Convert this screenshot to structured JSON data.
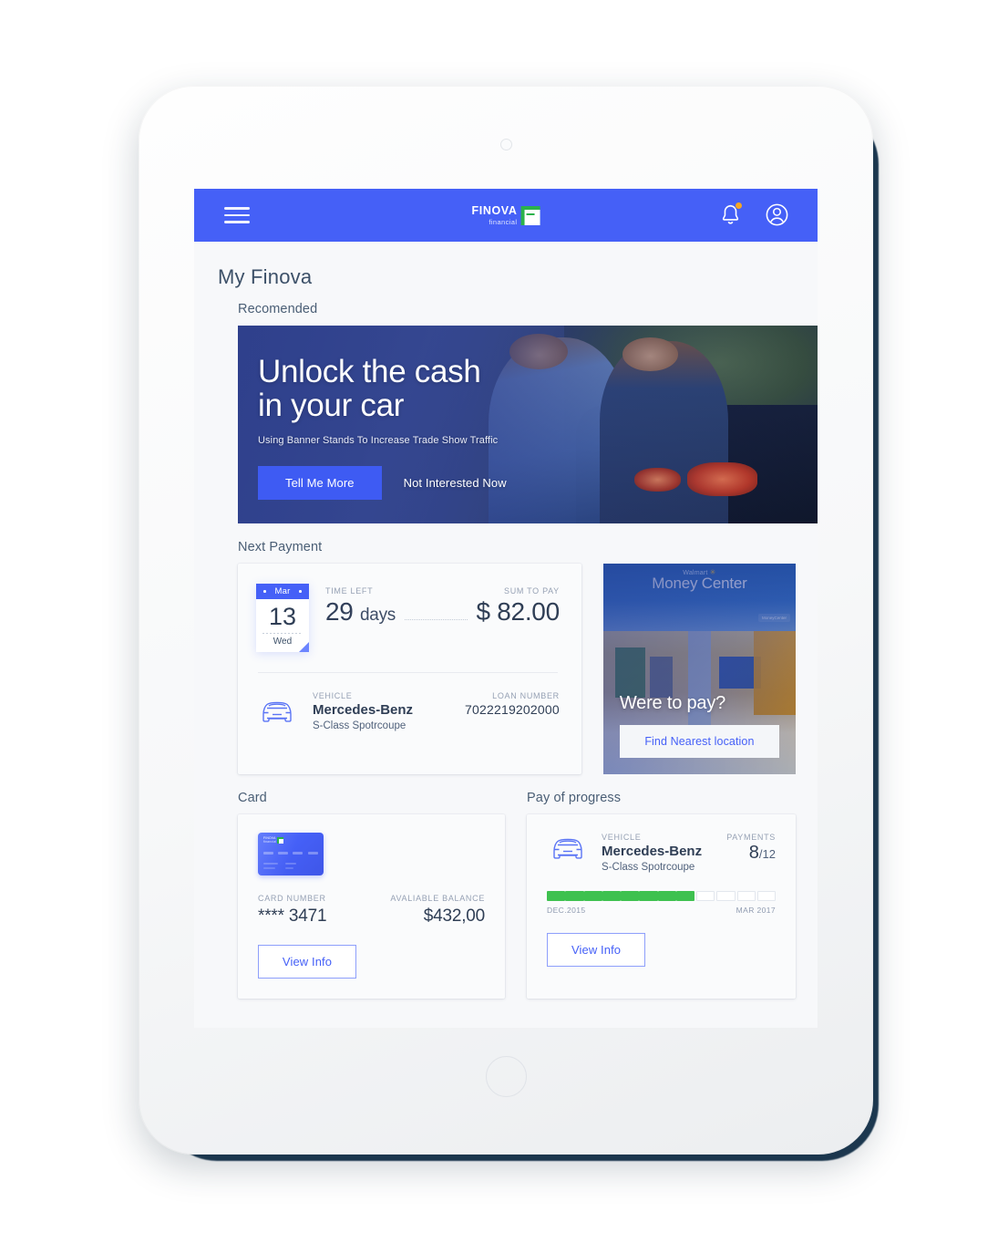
{
  "appbar": {
    "menu_label": "menu",
    "brand_main": "FINOVA",
    "brand_sub": "financial",
    "notifications_label": "notifications",
    "profile_label": "profile"
  },
  "page": {
    "title": "My Finova"
  },
  "recommended": {
    "section_label": "Recomended",
    "hero_title_line1": "Unlock the cash",
    "hero_title_line2": "in your car",
    "hero_subtitle": "Using Banner Stands To Increase Trade Show Traffic",
    "primary_cta": "Tell Me More",
    "secondary_cta": "Not Interested Now"
  },
  "next_payment": {
    "section_label": "Next Payment",
    "calendar": {
      "month": "Mar",
      "day": "13",
      "weekday": "Wed"
    },
    "time_left_label": "TIME LEFT",
    "time_left_value": "29",
    "time_left_unit": "days",
    "sum_to_pay_label": "SUM TO PAY",
    "sum_to_pay_value": "$ 82.00",
    "vehicle_label": "VEHICLE",
    "vehicle_name": "Mercedes-Benz",
    "vehicle_model": "S-Class Spotrcoupe",
    "loan_number_label": "LOAN NUMBER",
    "loan_number_value": "7022219202000"
  },
  "walmart_promo": {
    "brand": "Walmart",
    "brand_star": "✳",
    "sign_title": "Money Center",
    "chip_text": "MoneyCenter",
    "headline": "Were to pay?",
    "button_label": "Find Nearest location"
  },
  "card": {
    "section_label": "Card",
    "card_logo_main": "FINOVA",
    "card_logo_sub": "financial",
    "card_number_label": "CARD NUMBER",
    "card_number_value": "**** 3471",
    "balance_label": "AVALIABLE BALANCE",
    "balance_value": "$432,00",
    "view_info_label": "View Info"
  },
  "pay_progress": {
    "section_label": "Pay of progress",
    "vehicle_label": "VEHICLE",
    "vehicle_name": "Mercedes-Benz",
    "vehicle_model": "S-Class Spotrcoupe",
    "payments_label": "PAYMENTS",
    "payments_done": "8",
    "payments_total": "/12",
    "start_label": "DEC.2015",
    "end_label": "MAR 2017",
    "segments_total": 12,
    "segments_filled": 8,
    "view_info_label": "View Info"
  },
  "colors": {
    "brand_blue": "#4560f7",
    "accent_green": "#3ec14f",
    "badge_orange": "#f5a623",
    "text_dark": "#2f3e55",
    "text_muted": "#96a1b4",
    "screen_bg": "#f7f8fa"
  }
}
